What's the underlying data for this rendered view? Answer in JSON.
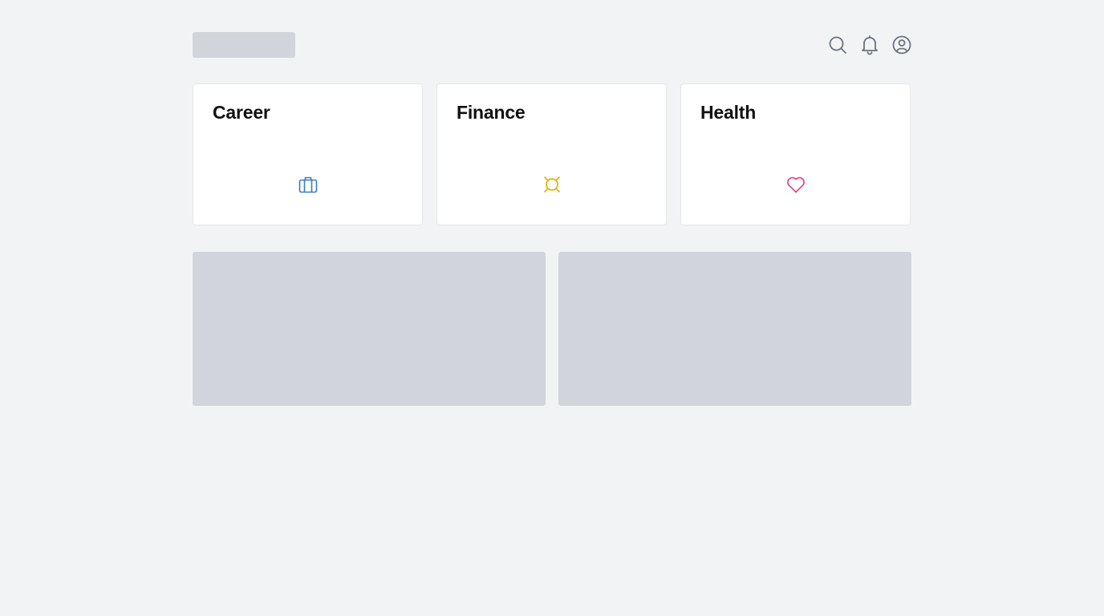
{
  "header": {
    "icons": [
      "search-icon",
      "bell-icon",
      "user-circle-icon"
    ]
  },
  "cards": [
    {
      "title": "Career",
      "icon": "briefcase-icon",
      "color": "#3b7bbf"
    },
    {
      "title": "Finance",
      "icon": "currency-icon",
      "color": "#e0b400"
    },
    {
      "title": "Health",
      "icon": "heart-icon",
      "color": "#e0468f"
    }
  ],
  "colors": {
    "background": "#f2f3f5",
    "skeleton": "#d1d5db",
    "icon_gray": "#6b7280"
  }
}
